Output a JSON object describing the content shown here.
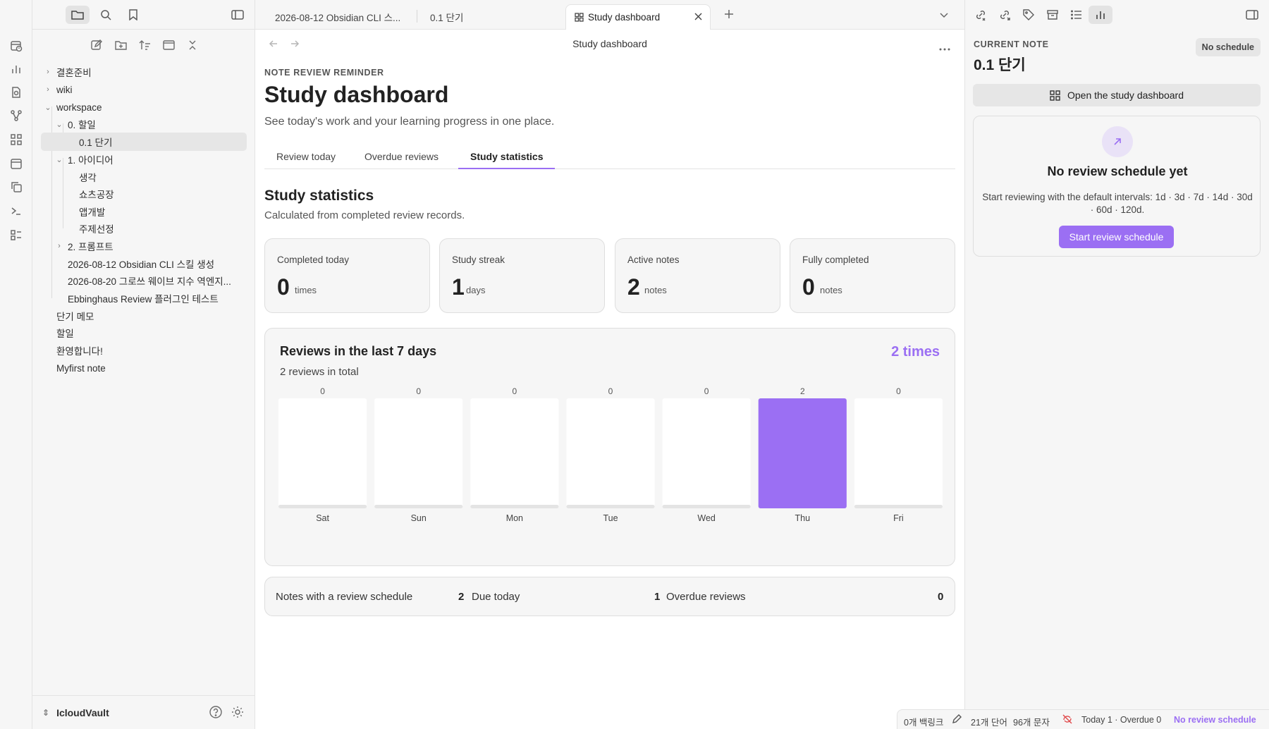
{
  "ribbon": {
    "icons": [
      "calendar-clock-icon",
      "bar-chart-icon",
      "file-search-icon",
      "graph-icon",
      "grid-icon",
      "calendar-icon",
      "copy-icon",
      "terminal-icon",
      "list-checks-icon"
    ]
  },
  "file_explorer": {
    "tree": [
      {
        "label": "결혼준비",
        "type": "folder",
        "expanded": false
      },
      {
        "label": "wiki",
        "type": "folder",
        "expanded": false
      },
      {
        "label": "workspace",
        "type": "folder",
        "expanded": true
      },
      {
        "label": "0. 할일",
        "type": "folder",
        "expanded": true
      },
      {
        "label": "0.1 단기",
        "type": "file",
        "selected": true
      },
      {
        "label": "1. 아이디어",
        "type": "folder",
        "expanded": true
      },
      {
        "label": "생각",
        "type": "file"
      },
      {
        "label": "쇼츠공장",
        "type": "file"
      },
      {
        "label": "앱개발",
        "type": "file"
      },
      {
        "label": "주제선정",
        "type": "file"
      },
      {
        "label": "2. 프롬프트",
        "type": "folder",
        "expanded": false
      },
      {
        "label": "2026-08-12 Obsidian CLI 스킬 생성",
        "type": "file"
      },
      {
        "label": "2026-08-20 그로쓰 웨이브 지수 역엔지...",
        "type": "file"
      },
      {
        "label": "Ebbinghaus Review 플러그인 테스트",
        "type": "file"
      },
      {
        "label": "단기 메모",
        "type": "file"
      },
      {
        "label": "할일",
        "type": "file"
      },
      {
        "label": "환영합니다!",
        "type": "file"
      },
      {
        "label": "Myfirst note",
        "type": "file"
      }
    ],
    "vault_name": "IcloudVault"
  },
  "tabs": [
    {
      "label": "2026-08-12 Obsidian CLI 스..."
    },
    {
      "label": "0.1 단기"
    },
    {
      "label": "Study dashboard",
      "active": true
    }
  ],
  "view": {
    "header_title": "Study dashboard",
    "eyebrow": "NOTE REVIEW REMINDER",
    "title": "Study dashboard",
    "subtitle": "See today's work and your learning progress in one place.",
    "subtabs": [
      "Review today",
      "Overdue reviews",
      "Study statistics"
    ],
    "active_subtab": "Study statistics",
    "section_title": "Study statistics",
    "section_subtitle": "Calculated from completed review records.",
    "cards": [
      {
        "label": "Completed today",
        "value": "0",
        "unit": "times"
      },
      {
        "label": "Study streak",
        "value": "1",
        "unit": "days"
      },
      {
        "label": "Active notes",
        "value": "2",
        "unit": "notes"
      },
      {
        "label": "Fully completed",
        "value": "0",
        "unit": "notes"
      }
    ],
    "chart_title": "Reviews in the last 7 days",
    "chart_subtitle": "2 reviews in total",
    "chart_total": "2 times",
    "summary": {
      "scheduled_label": "Notes with a review schedule",
      "scheduled_value": "2",
      "due_label": "Due today",
      "due_value": "1",
      "overdue_label": "Overdue reviews",
      "overdue_value": "0"
    }
  },
  "chart_data": {
    "type": "bar",
    "categories": [
      "Sat",
      "Sun",
      "Mon",
      "Tue",
      "Wed",
      "Thu",
      "Fri"
    ],
    "values": [
      0,
      0,
      0,
      0,
      0,
      2,
      0
    ],
    "title": "Reviews in the last 7 days",
    "xlabel": "",
    "ylabel": "",
    "ylim": [
      0,
      2
    ],
    "bar_color": "#9b6ff3",
    "track_color": "#ffffff",
    "grid": false
  },
  "right_panel": {
    "current_label": "CURRENT NOTE",
    "current_note": "0.1 단기",
    "badge": "No schedule",
    "open_button": "Open the study dashboard",
    "empty_title": "No review schedule yet",
    "empty_desc": "Start reviewing with the default intervals: 1d · 3d · 7d · 14d · 30d · 60d · 120d.",
    "start_button": "Start review schedule"
  },
  "statusbar": {
    "backlinks": "0개 백링크",
    "words": "21개 단어",
    "chars": "96개 문자",
    "today": "Today 1 · Overdue 0",
    "schedule": "No review schedule"
  },
  "colors": {
    "accent": "#9b6ff3",
    "bg_panel": "#f6f6f6",
    "border": "#e3e3e3"
  }
}
